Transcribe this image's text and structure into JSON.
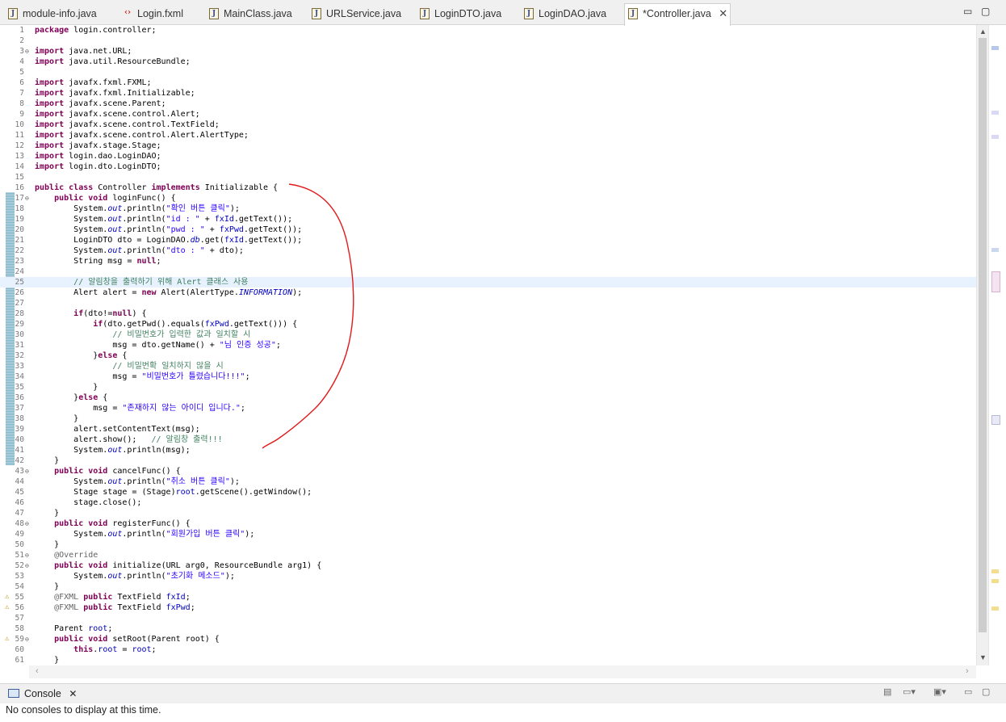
{
  "tabs": [
    {
      "label": "module-info.java",
      "icon": "java-file-icon"
    },
    {
      "label": "Login.fxml",
      "icon": "fxml-file-icon"
    },
    {
      "label": "MainClass.java",
      "icon": "java-file-icon"
    },
    {
      "label": "URLService.java",
      "icon": "java-file-icon"
    },
    {
      "label": "LoginDTO.java",
      "icon": "java-file-icon"
    },
    {
      "label": "LoginDAO.java",
      "icon": "java-file-icon"
    },
    {
      "label": "*Controller.java",
      "icon": "java-file-icon",
      "active": true
    }
  ],
  "window_controls": {
    "minimize": "▭",
    "maximize": "▢"
  },
  "editor": {
    "current_line": 25,
    "lines": [
      {
        "n": "1",
        "t": "package login.controller;"
      },
      {
        "n": "2",
        "t": ""
      },
      {
        "n": "3",
        "t": "import java.net.URL;"
      },
      {
        "n": "4",
        "t": "import java.util.ResourceBundle;"
      },
      {
        "n": "5",
        "t": ""
      },
      {
        "n": "6",
        "t": "import javafx.fxml.FXML;"
      },
      {
        "n": "7",
        "t": "import javafx.fxml.Initializable;"
      },
      {
        "n": "8",
        "t": "import javafx.scene.Parent;"
      },
      {
        "n": "9",
        "t": "import javafx.scene.control.Alert;"
      },
      {
        "n": "10",
        "t": "import javafx.scene.control.TextField;"
      },
      {
        "n": "11",
        "t": "import javafx.scene.control.Alert.AlertType;"
      },
      {
        "n": "12",
        "t": "import javafx.stage.Stage;"
      },
      {
        "n": "13",
        "t": "import login.dao.LoginDAO;"
      },
      {
        "n": "14",
        "t": "import login.dto.LoginDTO;"
      },
      {
        "n": "15",
        "t": ""
      },
      {
        "n": "16",
        "t": "public class Controller implements Initializable {"
      },
      {
        "n": "17",
        "t": "    public void loginFunc() {"
      },
      {
        "n": "18",
        "t": "        System.out.println(\"확인 버튼 클릭\");"
      },
      {
        "n": "19",
        "t": "        System.out.println(\"id : \" + fxId.getText());"
      },
      {
        "n": "20",
        "t": "        System.out.println(\"pwd : \" + fxPwd.getText());"
      },
      {
        "n": "21",
        "t": "        LoginDTO dto = LoginDAO.db.get(fxId.getText());"
      },
      {
        "n": "22",
        "t": "        System.out.println(\"dto : \" + dto);"
      },
      {
        "n": "23",
        "t": "        String msg = null;"
      },
      {
        "n": "24",
        "t": ""
      },
      {
        "n": "25",
        "t": "        // 알림창을 출력하기 위해 Alert 클래스 사용"
      },
      {
        "n": "26",
        "t": "        Alert alert = new Alert(AlertType.INFORMATION);"
      },
      {
        "n": "27",
        "t": ""
      },
      {
        "n": "28",
        "t": "        if(dto!=null) {"
      },
      {
        "n": "29",
        "t": "            if(dto.getPwd().equals(fxPwd.getText())) {"
      },
      {
        "n": "30",
        "t": "                // 비밀번호가 입력한 값과 일치할 시"
      },
      {
        "n": "31",
        "t": "                msg = dto.getName() + \"님 인증 성공\";"
      },
      {
        "n": "32",
        "t": "            }else {"
      },
      {
        "n": "33",
        "t": "                // 비밀번확 일치하지 않을 시"
      },
      {
        "n": "34",
        "t": "                msg = \"비밀번호가 틀렸습니다!!!\";"
      },
      {
        "n": "35",
        "t": "            }"
      },
      {
        "n": "36",
        "t": "        }else {"
      },
      {
        "n": "37",
        "t": "            msg = \"존재하지 않는 아이디 입니다.\";"
      },
      {
        "n": "38",
        "t": "        }"
      },
      {
        "n": "39",
        "t": "        alert.setContentText(msg);"
      },
      {
        "n": "40",
        "t": "        alert.show();   // 알림창 출력!!!"
      },
      {
        "n": "41",
        "t": "        System.out.println(msg);"
      },
      {
        "n": "42",
        "t": "    }"
      },
      {
        "n": "43",
        "t": "    public void cancelFunc() {"
      },
      {
        "n": "44",
        "t": "        System.out.println(\"취소 버튼 클릭\");"
      },
      {
        "n": "45",
        "t": "        Stage stage = (Stage)root.getScene().getWindow();"
      },
      {
        "n": "46",
        "t": "        stage.close();"
      },
      {
        "n": "47",
        "t": "    }"
      },
      {
        "n": "48",
        "t": "    public void registerFunc() {"
      },
      {
        "n": "49",
        "t": "        System.out.println(\"회원가입 버튼 클릭\");"
      },
      {
        "n": "50",
        "t": "    }"
      },
      {
        "n": "51",
        "t": "    @Override"
      },
      {
        "n": "52",
        "t": "    public void initialize(URL arg0, ResourceBundle arg1) {"
      },
      {
        "n": "53",
        "t": "        System.out.println(\"초기화 메소드\");"
      },
      {
        "n": "54",
        "t": "    }"
      },
      {
        "n": "55",
        "t": "    @FXML public TextField fxId;"
      },
      {
        "n": "56",
        "t": "    @FXML public TextField fxPwd;"
      },
      {
        "n": "57",
        "t": ""
      },
      {
        "n": "58",
        "t": "    Parent root;"
      },
      {
        "n": "59",
        "t": "    public void setRoot(Parent root) {"
      },
      {
        "n": "60",
        "t": "        this.root = root;"
      },
      {
        "n": "61",
        "t": "    }"
      }
    ]
  },
  "console": {
    "tab_label": "Console",
    "message": "No consoles to display at this time."
  }
}
